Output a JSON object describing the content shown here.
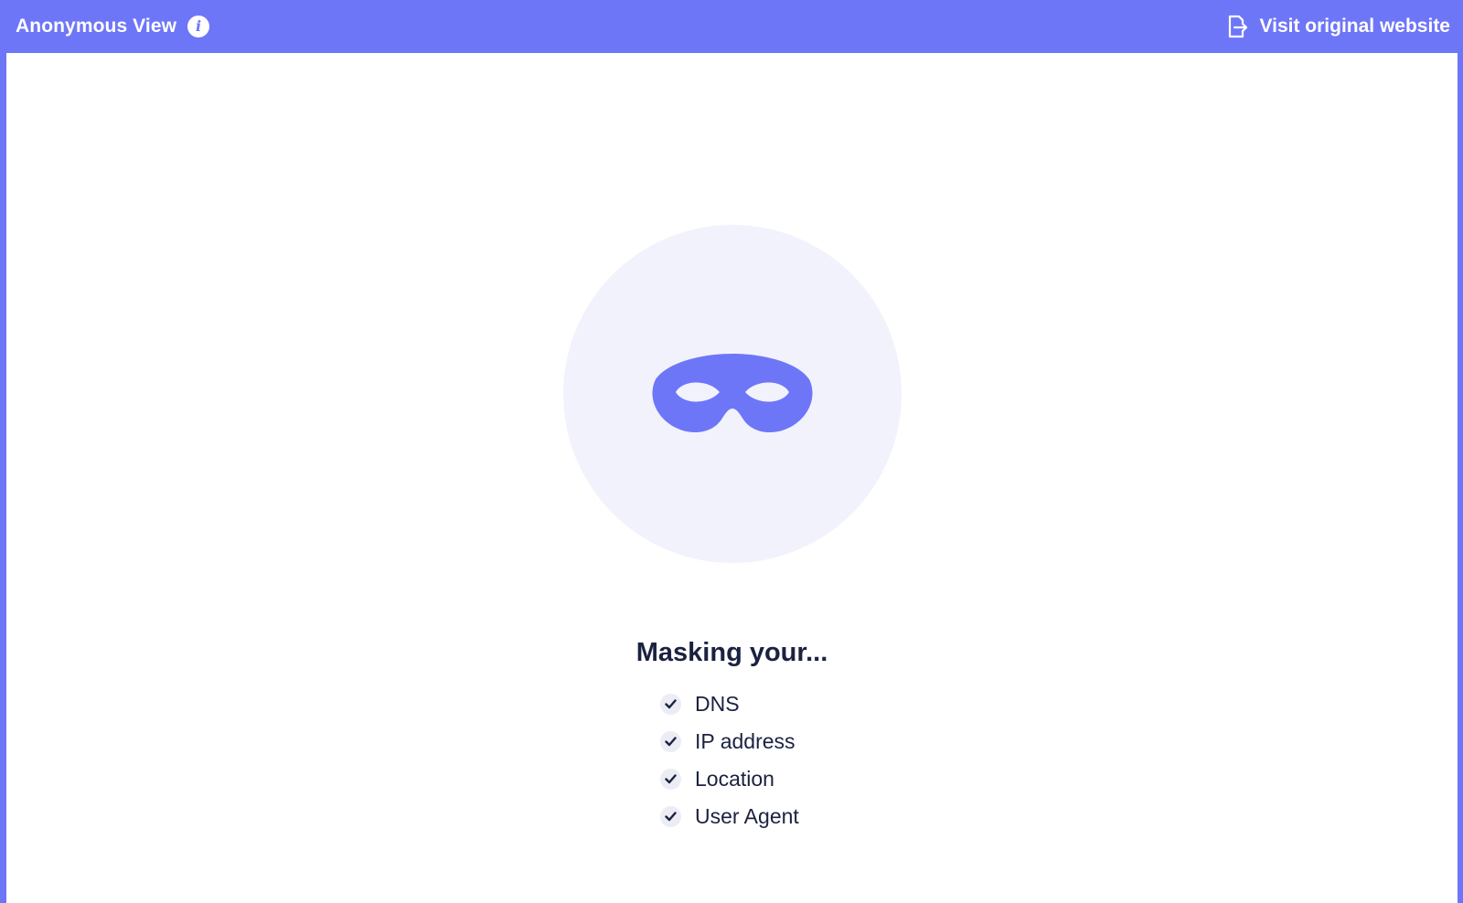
{
  "topbar": {
    "title": "Anonymous View",
    "info_glyph": "i",
    "visit_label": "Visit original website",
    "icons": [
      "info-icon",
      "exit-icon"
    ]
  },
  "main": {
    "illustration_icon": "mask-icon",
    "heading": "Masking your...",
    "items": [
      {
        "label": "DNS",
        "icon": "check-icon"
      },
      {
        "label": "IP address",
        "icon": "check-icon"
      },
      {
        "label": "Location",
        "icon": "check-icon"
      },
      {
        "label": "User Agent",
        "icon": "check-icon"
      }
    ]
  },
  "colors": {
    "accent": "#6e76f8",
    "circle_bg": "#f2f2fc",
    "text_dark": "#1b2240",
    "check_bg": "#ececf5"
  }
}
